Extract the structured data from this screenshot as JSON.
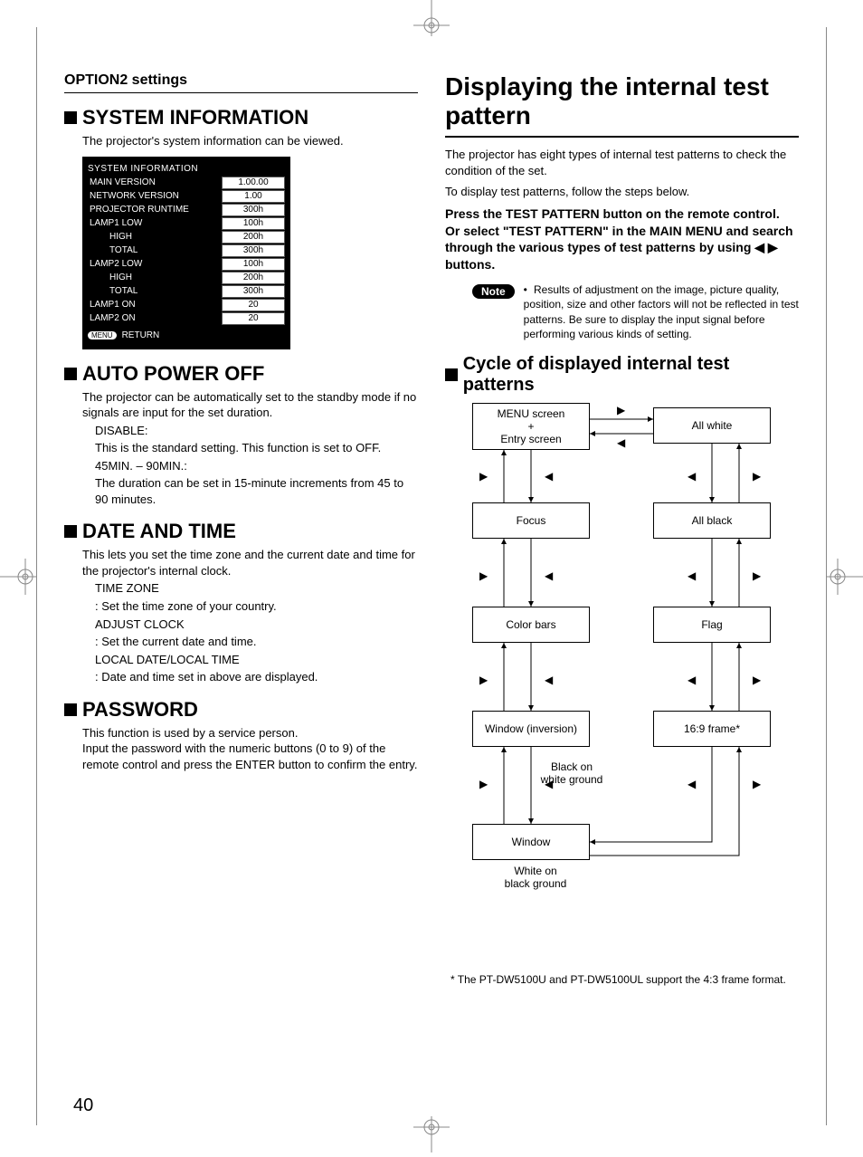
{
  "pageNumber": "40",
  "left": {
    "breadcrumb": "OPTION2 settings",
    "systemInformation": {
      "heading": "SYSTEM INFORMATION",
      "intro": "The projector's system information can be viewed.",
      "boxTitle": "SYSTEM INFORMATION",
      "rows": [
        {
          "k": "MAIN VERSION",
          "v": "1.00.00",
          "indent": false
        },
        {
          "k": "NETWORK VERSION",
          "v": "1.00",
          "indent": false
        },
        {
          "k": "PROJECTOR RUNTIME",
          "v": "300h",
          "indent": false
        },
        {
          "k": "LAMP1 LOW",
          "v": "100h",
          "indent": false
        },
        {
          "k": "HIGH",
          "v": "200h",
          "indent": true
        },
        {
          "k": "TOTAL",
          "v": "300h",
          "indent": true
        },
        {
          "k": "LAMP2 LOW",
          "v": "100h",
          "indent": false
        },
        {
          "k": "HIGH",
          "v": "200h",
          "indent": true
        },
        {
          "k": "TOTAL",
          "v": "300h",
          "indent": true
        },
        {
          "k": "LAMP1 ON",
          "v": "20",
          "indent": false
        },
        {
          "k": "LAMP2 ON",
          "v": "20",
          "indent": false
        }
      ],
      "returnBtn": "MENU",
      "returnText": "RETURN"
    },
    "autoPowerOff": {
      "heading": "AUTO POWER OFF",
      "intro": "The projector can be automatically set to the standby mode if no signals are input for the set duration.",
      "items": [
        {
          "term": "DISABLE:",
          "desc": "This is the standard setting. This function is set to OFF."
        },
        {
          "term": "45MIN. – 90MIN.:",
          "desc": "The duration can be set in 15-minute increments from 45 to 90 minutes."
        }
      ]
    },
    "dateAndTime": {
      "heading": "DATE AND TIME",
      "intro": "This lets you set the time zone and the current date and time for the projector's internal clock.",
      "items": [
        {
          "term": "TIME ZONE",
          "desc": ": Set the time zone of your country."
        },
        {
          "term": "ADJUST CLOCK",
          "desc": ": Set the current date and time."
        },
        {
          "term": "LOCAL DATE/LOCAL TIME",
          "desc": ": Date and time set in above are displayed."
        }
      ]
    },
    "password": {
      "heading": "PASSWORD",
      "body": "This function is used by a service person.\nInput the password with the numeric buttons (0 to 9) of the remote control and press the ENTER button to confirm the entry."
    }
  },
  "right": {
    "title": "Displaying the internal test pattern",
    "intro1": "The projector has eight types of internal test patterns to check the condition of the set.",
    "intro2": "To display test patterns, follow the steps below.",
    "instruction": "Press the TEST PATTERN button on the remote control.\nOr select \"TEST PATTERN\" in the MAIN MENU and search through the various types of test  patterns by using ◀  ▶ buttons.",
    "note": {
      "badge": "Note",
      "text": "Results of adjustment on the image, picture quality, position, size and other factors will not be reflected in test patterns. Be sure to display the input signal before performing various kinds of setting."
    },
    "cycle": {
      "heading": "Cycle of displayed internal test patterns",
      "nodes": {
        "menu": "MENU screen\n+\nEntry screen",
        "allwhite": "All white",
        "focus": "Focus",
        "allblack": "All black",
        "colorbars": "Color bars",
        "flag": "Flag",
        "windowinv": "Window (inversion)",
        "frame169": "16:9 frame*",
        "window": "Window"
      },
      "labels": {
        "blackOnWhite": "Black on\nwhite ground",
        "whiteOnBlack": "White on\nblack ground"
      },
      "footnote": "* The PT-DW5100U and PT-DW5100UL support the 4:3 frame format."
    }
  }
}
